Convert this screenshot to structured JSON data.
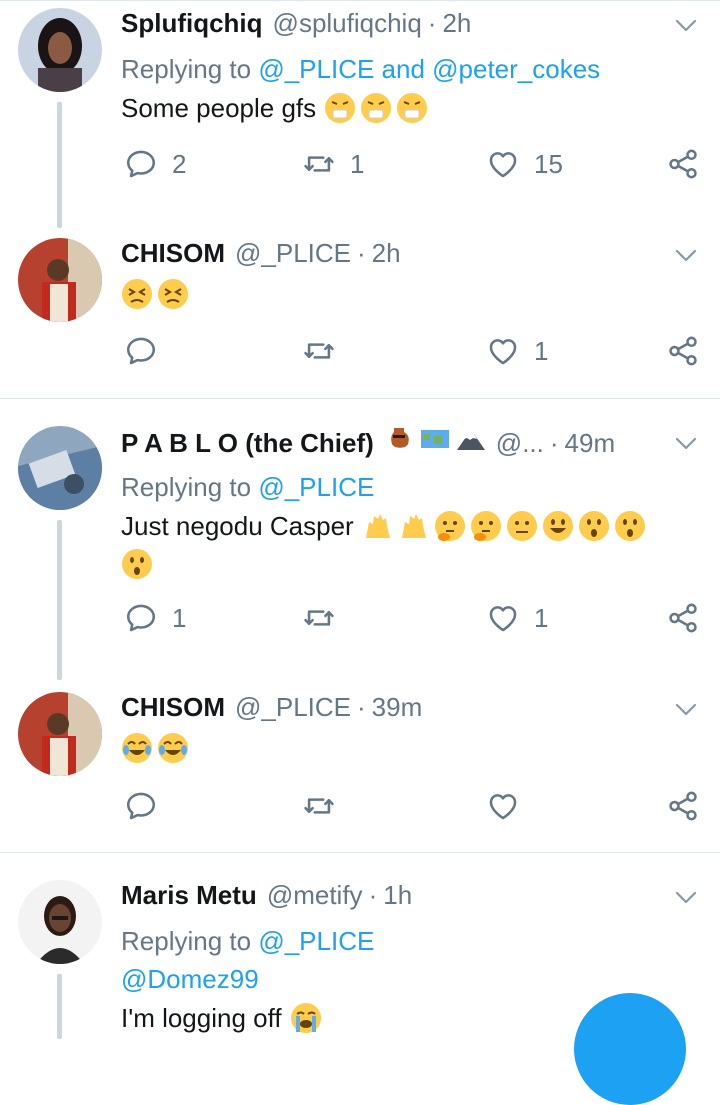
{
  "tweets": [
    {
      "name": "Splufiqchiq",
      "handle": "@splufiqchiq",
      "time": "2h",
      "replying_prefix": "Replying to ",
      "replying_to": "@_PLICE and @peter_cokes",
      "text": "Some people gfs",
      "emojis": [
        "sneezing-face",
        "sneezing-face",
        "sneezing-face"
      ],
      "replies": "2",
      "retweets": "1",
      "likes": "15"
    },
    {
      "name": "CHISOM",
      "handle": "@_PLICE",
      "time": "2h",
      "emojis": [
        "persevering-face",
        "persevering-face"
      ],
      "replies": "",
      "retweets": "",
      "likes": "1"
    },
    {
      "name": "P A B L O (the Chief)",
      "name_emojis": [
        "amphora",
        "world-map",
        "mount-fuji"
      ],
      "handle": "@...",
      "time": "49m",
      "replying_prefix": "Replying to ",
      "replying_to": "@_PLICE",
      "text": "Just negodu Casper",
      "emojis": [
        "raising-hands",
        "raising-hands",
        "thinking-face",
        "thinking-face",
        "neutral-face",
        "grinning-face",
        "hushed-face",
        "hushed-face",
        "hushed-face"
      ],
      "replies": "1",
      "retweets": "",
      "likes": "1"
    },
    {
      "name": "CHISOM",
      "handle": "@_PLICE",
      "time": "39m",
      "emojis": [
        "tears-of-joy",
        "tears-of-joy"
      ],
      "replies": "",
      "retweets": "",
      "likes": ""
    },
    {
      "name": "Maris Metu",
      "handle": "@metify",
      "time": "1h",
      "replying_prefix": "Replying to ",
      "replying_to": "@_PLICE",
      "mention": "@Domez99",
      "text": "I'm logging off",
      "emojis": [
        "loudly-crying-face"
      ]
    }
  ],
  "dot": "·",
  "colors": {
    "accent": "#1da1f2",
    "secondary_text": "#657786",
    "divider": "#e1e8ed",
    "emoji_yellow": "#ffcc4d"
  }
}
